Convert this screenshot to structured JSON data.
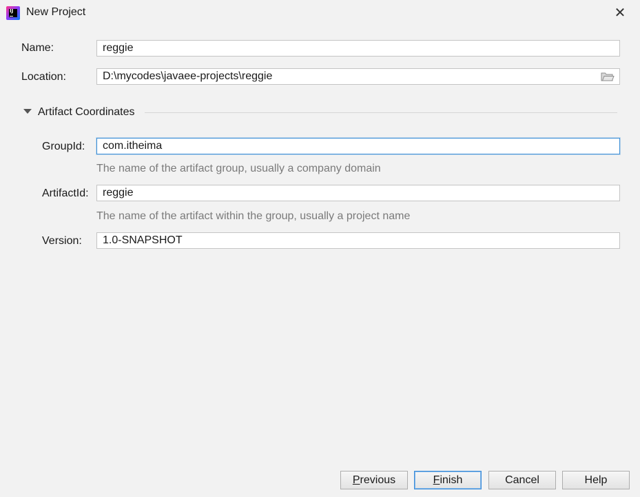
{
  "window": {
    "title": "New Project",
    "app_icon": "intellij-idea-icon",
    "close_icon": "close-icon",
    "close_glyph": "✕"
  },
  "form": {
    "name_label": "Name:",
    "name_value": "reggie",
    "location_label": "Location:",
    "location_value": "D:\\mycodes\\javaee-projects\\reggie",
    "browse_icon": "folder-icon"
  },
  "artifact": {
    "section_title": "Artifact Coordinates",
    "expanded": true,
    "groupid_label": "GroupId:",
    "groupid_value": "com.itheima",
    "groupid_hint": "The name of the artifact group, usually a company domain",
    "artifactid_label": "ArtifactId:",
    "artifactid_value": "reggie",
    "artifactid_hint": "The name of the artifact within the group, usually a project name",
    "version_label": "Version:",
    "version_value": "1.0-SNAPSHOT"
  },
  "buttons": {
    "previous_first": "P",
    "previous_rest": "revious",
    "finish_first": "F",
    "finish_rest": "inish",
    "cancel": "Cancel",
    "help": "Help"
  },
  "colors": {
    "background": "#f2f2f2",
    "focus_border": "#3d8fd6",
    "hint_text": "#7a7a7a",
    "default_button_border": "#3c8ddb"
  }
}
